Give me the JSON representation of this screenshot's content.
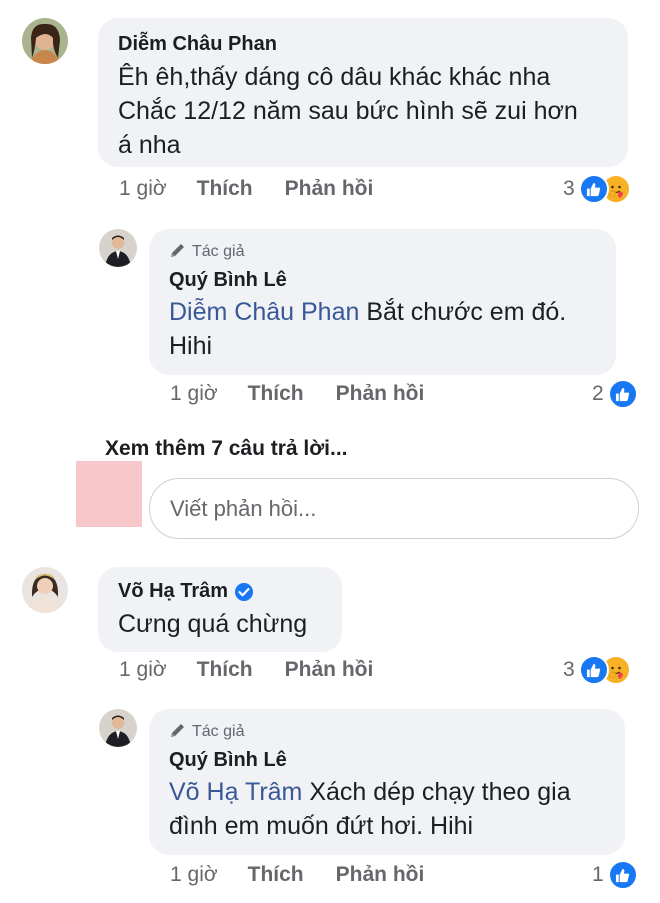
{
  "comments": [
    {
      "name": "Diễm Châu Phan",
      "lines": [
        "Êh êh,thấy dáng cô dâu khác khác nha",
        "Chắc 12/12 năm sau bức hình sẽ zui hơn",
        "á nha"
      ],
      "time": "1 giờ",
      "like_label": "Thích",
      "reply_label": "Phản hồi",
      "reaction_count": "3",
      "reactions": [
        "like-icon",
        "care-icon"
      ]
    },
    {
      "author_badge": "Tác giả",
      "name": "Quý Bình Lê",
      "mention": "Diễm Châu Phan",
      "text_after_mention": " Bắt chước em đó.",
      "line2": "Hihi",
      "time": "1 giờ",
      "like_label": "Thích",
      "reply_label": "Phản hồi",
      "reaction_count": "2",
      "reactions": [
        "like-icon"
      ]
    },
    {
      "name": "Võ Hạ Trâm",
      "verified": true,
      "text": "Cưng quá chừng",
      "time": "1 giờ",
      "like_label": "Thích",
      "reply_label": "Phản hồi",
      "reaction_count": "3",
      "reactions": [
        "like-icon",
        "care-icon"
      ]
    },
    {
      "author_badge": "Tác giả",
      "name": "Quý Bình Lê",
      "mention": "Võ Hạ Trâm",
      "text_after_mention": " Xách dép chạy theo gia",
      "line2": "đình em muốn đứt hơi. Hihi",
      "time": "1 giờ",
      "like_label": "Thích",
      "reply_label": "Phản hồi",
      "reaction_count": "1",
      "reactions": [
        "like-icon"
      ]
    }
  ],
  "see_more_replies": "Xem thêm 7 câu trả lời...",
  "reply_input": {
    "placeholder": "Viết phản hồi..."
  },
  "colors": {
    "bubble": "#f0f2f5",
    "mention": "#385898",
    "like_blue": "#1877f2",
    "care_yellow": "#f7b125",
    "redacted_pink": "#f7c7c9"
  }
}
